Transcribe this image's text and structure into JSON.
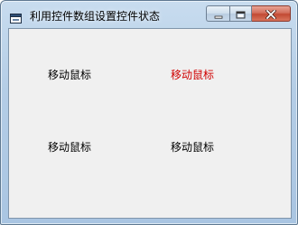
{
  "window": {
    "title": "利用控件数组设置控件状态"
  },
  "labels": [
    {
      "text": "移动鼠标",
      "color": "#000000"
    },
    {
      "text": "移动鼠标",
      "color": "#d00000"
    },
    {
      "text": "移动鼠标",
      "color": "#000000"
    },
    {
      "text": "移动鼠标",
      "color": "#000000"
    }
  ],
  "icons": {
    "app": "form-window-icon",
    "minimize": "minimize-icon",
    "maximize": "maximize-icon",
    "close": "close-icon"
  }
}
